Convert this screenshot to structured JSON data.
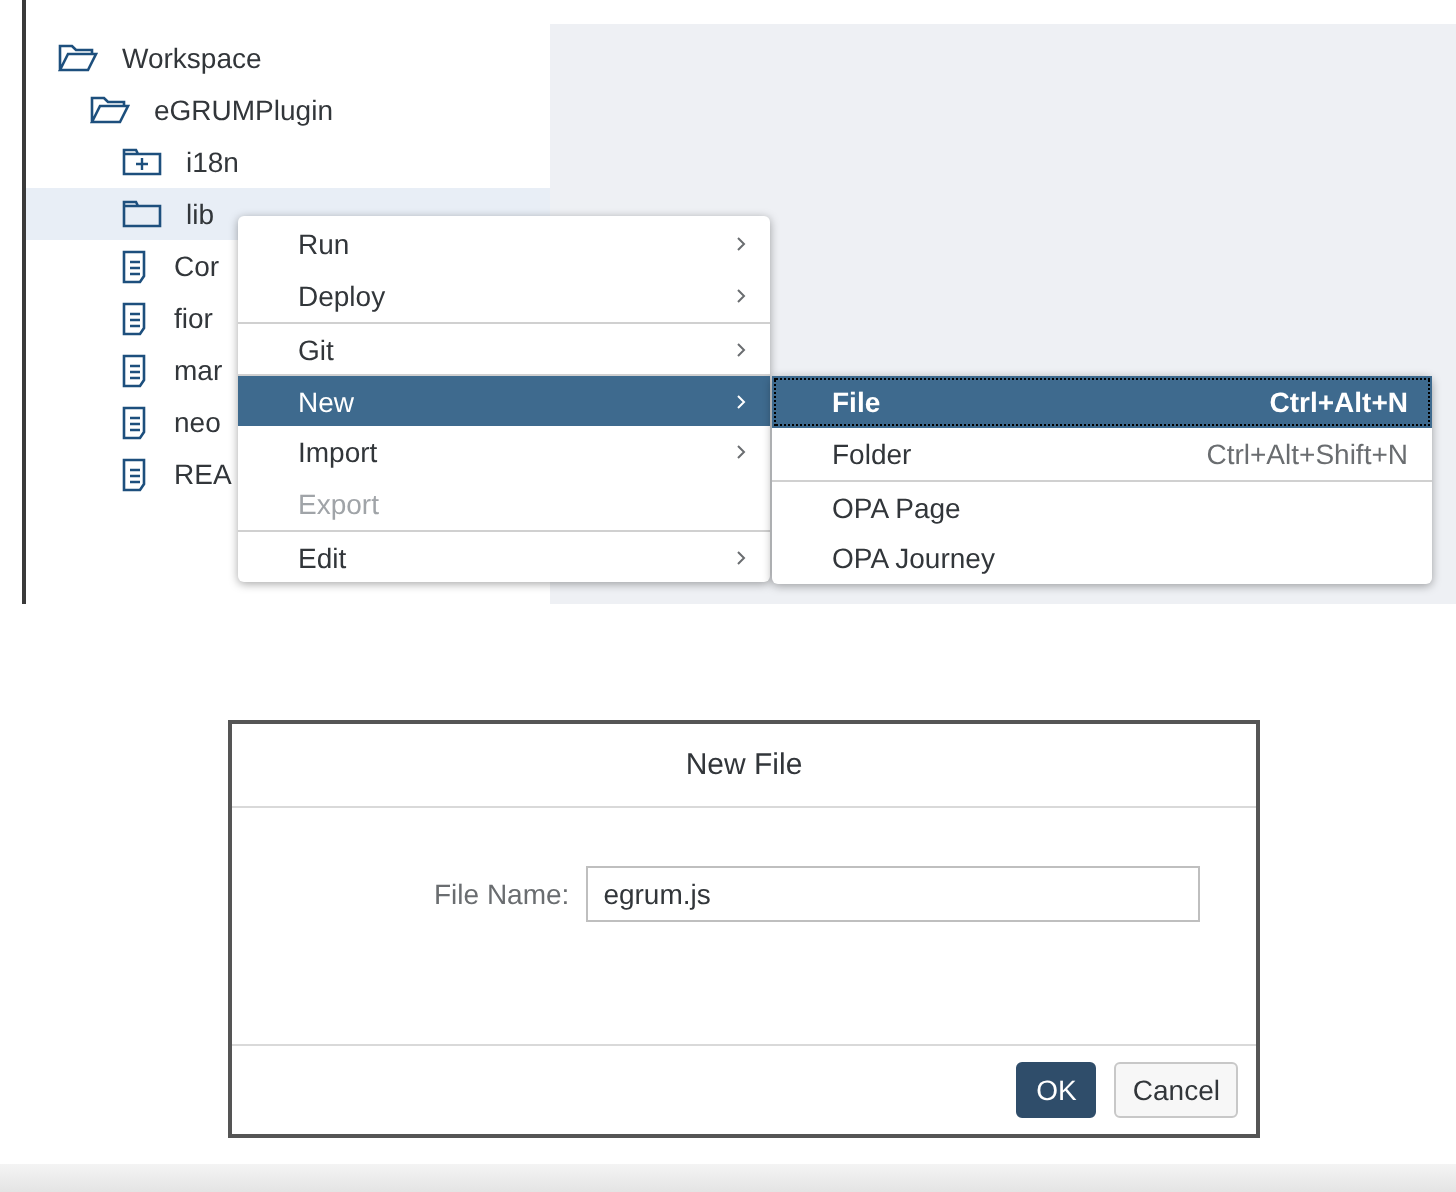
{
  "tree": [
    {
      "label": "Workspace",
      "kind": "folder-open",
      "selected": false,
      "children": [
        {
          "label": "eGRUMPlugin",
          "kind": "folder-open",
          "selected": false,
          "children": [
            {
              "label": "i18n",
              "kind": "folder-plus",
              "selected": false
            },
            {
              "label": "lib",
              "kind": "folder",
              "selected": true
            },
            {
              "label": "Cor",
              "kind": "file",
              "selected": false
            },
            {
              "label": "fior",
              "kind": "file",
              "selected": false
            },
            {
              "label": "mar",
              "kind": "file",
              "selected": false
            },
            {
              "label": "neo",
              "kind": "file",
              "selected": false
            },
            {
              "label": "REA",
              "kind": "file",
              "selected": false
            }
          ]
        }
      ]
    }
  ],
  "context_menu": [
    {
      "label": "Run",
      "submenu": true,
      "disabled": false,
      "selected": false,
      "separator_before": false
    },
    {
      "label": "Deploy",
      "submenu": true,
      "disabled": false,
      "selected": false,
      "separator_before": false
    },
    {
      "label": "Git",
      "submenu": true,
      "disabled": false,
      "selected": false,
      "separator_before": true
    },
    {
      "label": "New",
      "submenu": true,
      "disabled": false,
      "selected": true,
      "separator_before": true
    },
    {
      "label": "Import",
      "submenu": true,
      "disabled": false,
      "selected": false,
      "separator_before": false
    },
    {
      "label": "Export",
      "submenu": false,
      "disabled": true,
      "selected": false,
      "separator_before": false
    },
    {
      "label": "Edit",
      "submenu": true,
      "disabled": false,
      "selected": false,
      "separator_before": true
    }
  ],
  "submenu": [
    {
      "label": "File",
      "shortcut": "Ctrl+Alt+N",
      "selected": true,
      "separator_before": false
    },
    {
      "label": "Folder",
      "shortcut": "Ctrl+Alt+Shift+N",
      "selected": false,
      "separator_before": false
    },
    {
      "label": "OPA Page",
      "selected": false,
      "separator_before": true
    },
    {
      "label": "OPA Journey",
      "selected": false,
      "separator_before": false
    }
  ],
  "dialog": {
    "title": "New File",
    "field_label": "File Name:",
    "field_value": "egrum.js",
    "buttons": [
      {
        "label": "OK",
        "kind": "primary"
      },
      {
        "label": "Cancel",
        "kind": "secondary"
      }
    ]
  }
}
